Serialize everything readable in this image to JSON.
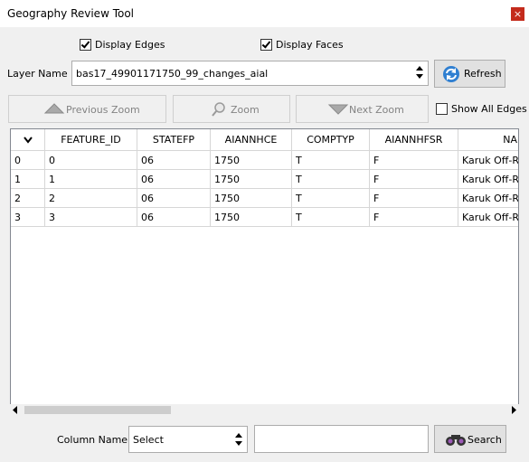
{
  "window": {
    "title": "Geography Review Tool",
    "close_glyph": "×"
  },
  "options": {
    "display_edges": "Display Edges",
    "display_edges_checked": true,
    "display_faces": "Display Faces",
    "display_faces_checked": true
  },
  "layer": {
    "label": "Layer Name :",
    "value": "bas17_49901171750_99_changes_aial"
  },
  "toolbar": {
    "refresh": "Refresh",
    "previous_zoom": "Previous Zoom",
    "zoom": "Zoom",
    "next_zoom": "Next Zoom",
    "show_all_edges": "Show All Edges",
    "show_all_edges_checked": false
  },
  "table": {
    "columns": [
      "",
      "FEATURE_ID",
      "STATEFP",
      "AIANNHCE",
      "COMPTYP",
      "AIANNHFSR",
      "NA"
    ],
    "rows": [
      [
        "0",
        "0",
        "06",
        "1750",
        "T",
        "F",
        "Karuk Off-Res"
      ],
      [
        "1",
        "1",
        "06",
        "1750",
        "T",
        "F",
        "Karuk Off-Res"
      ],
      [
        "2",
        "2",
        "06",
        "1750",
        "T",
        "F",
        "Karuk Off-Res"
      ],
      [
        "3",
        "3",
        "06",
        "1750",
        "T",
        "F",
        "Karuk Off-Res"
      ]
    ]
  },
  "search": {
    "column_label": "Column Name :",
    "column_value": "Select",
    "text": "",
    "button": "Search"
  },
  "colors": {
    "close": "#c42b1c",
    "refresh_icon": "#2f7fd1"
  }
}
